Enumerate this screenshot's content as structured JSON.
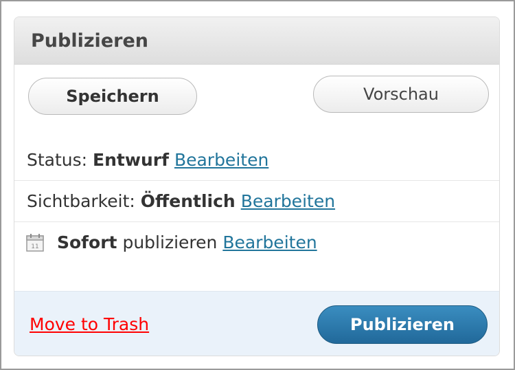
{
  "panel": {
    "title": "Publizieren"
  },
  "buttons": {
    "save_label": "Speichern",
    "preview_label": "Vorschau",
    "publish_label": "Publizieren"
  },
  "status": {
    "label": "Status:",
    "value": "Entwurf",
    "edit_label": "Bearbeiten"
  },
  "visibility": {
    "label": "Sichtbarkeit:",
    "value": "Öffentlich",
    "edit_label": "Bearbeiten"
  },
  "schedule": {
    "icon": "calendar-icon",
    "calendar_day": "11",
    "value": "Sofort",
    "suffix": "publizieren",
    "edit_label": "Bearbeiten"
  },
  "footer": {
    "trash_label": "Move to Trash"
  },
  "colors": {
    "link": "#21759b",
    "trash": "#ff0000",
    "publish_button": "#21699a",
    "footer_bg": "#eaf2fa"
  }
}
